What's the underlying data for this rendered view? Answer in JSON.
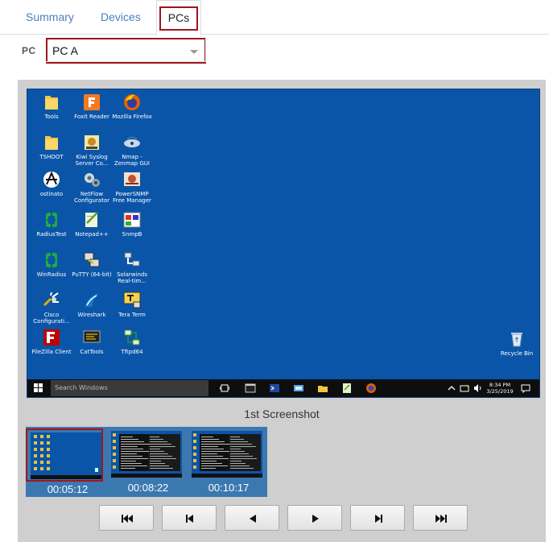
{
  "tabs": [
    {
      "label": "Summary"
    },
    {
      "label": "Devices"
    },
    {
      "label": "PCs"
    }
  ],
  "pc_selector": {
    "label": "PC",
    "value": "PC A"
  },
  "desktop": {
    "icons": [
      {
        "label": "Tools",
        "icon": "folder-icon"
      },
      {
        "label": "Foxit Reader",
        "icon": "foxit-reader-icon"
      },
      {
        "label": "Mozilla Firefox",
        "icon": "firefox-icon"
      },
      {
        "label": "TSHOOT",
        "icon": "folder-icon"
      },
      {
        "label": "Kiwi Syslog Server Co...",
        "icon": "kiwi-syslog-icon"
      },
      {
        "label": "Nmap - Zenmap GUI",
        "icon": "nmap-icon"
      },
      {
        "label": "ostinato",
        "icon": "ostinato-icon"
      },
      {
        "label": "NetFlow Configurator",
        "icon": "netflow-icon"
      },
      {
        "label": "PowerSNMP Free Manager",
        "icon": "powersnmp-icon"
      },
      {
        "label": "RadiusTest",
        "icon": "radiustest-icon"
      },
      {
        "label": "Notepad++",
        "icon": "notepad-plus-icon"
      },
      {
        "label": "SnmpB",
        "icon": "snmpb-icon"
      },
      {
        "label": "WinRadius",
        "icon": "winradius-icon"
      },
      {
        "label": "PuTTY (64-bit)",
        "icon": "putty-icon"
      },
      {
        "label": "Solarwinds Real-tim...",
        "icon": "solarwinds-icon"
      },
      {
        "label": "Cisco Configurati...",
        "icon": "cisco-config-icon"
      },
      {
        "label": "Wireshark",
        "icon": "wireshark-icon"
      },
      {
        "label": "Tera Term",
        "icon": "teraterm-icon"
      },
      {
        "label": "FileZilla Client",
        "icon": "filezilla-icon"
      },
      {
        "label": "CatTools",
        "icon": "cattools-icon"
      },
      {
        "label": "Tftpd64",
        "icon": "tftpd-icon"
      },
      {
        "label": "Recycle Bin",
        "icon": "recycle-bin-icon"
      }
    ],
    "taskbar": {
      "search_placeholder": "Search Windows",
      "time": "8:34 PM",
      "date": "3/25/2019"
    }
  },
  "screenshot_caption": "1st Screenshot",
  "thumbnails": [
    {
      "time": "00:05:12",
      "selected": true
    },
    {
      "time": "00:08:22",
      "selected": false
    },
    {
      "time": "00:10:17",
      "selected": false
    }
  ],
  "controls": [
    "first-button",
    "previous-button",
    "rewind-button",
    "play-button",
    "next-button",
    "last-button"
  ],
  "colors": {
    "highlight": "#a0151c",
    "tab_link": "#4a7fc1",
    "desktop_bg": "#0a55a8",
    "thumb_strip": "#3b78b0"
  }
}
